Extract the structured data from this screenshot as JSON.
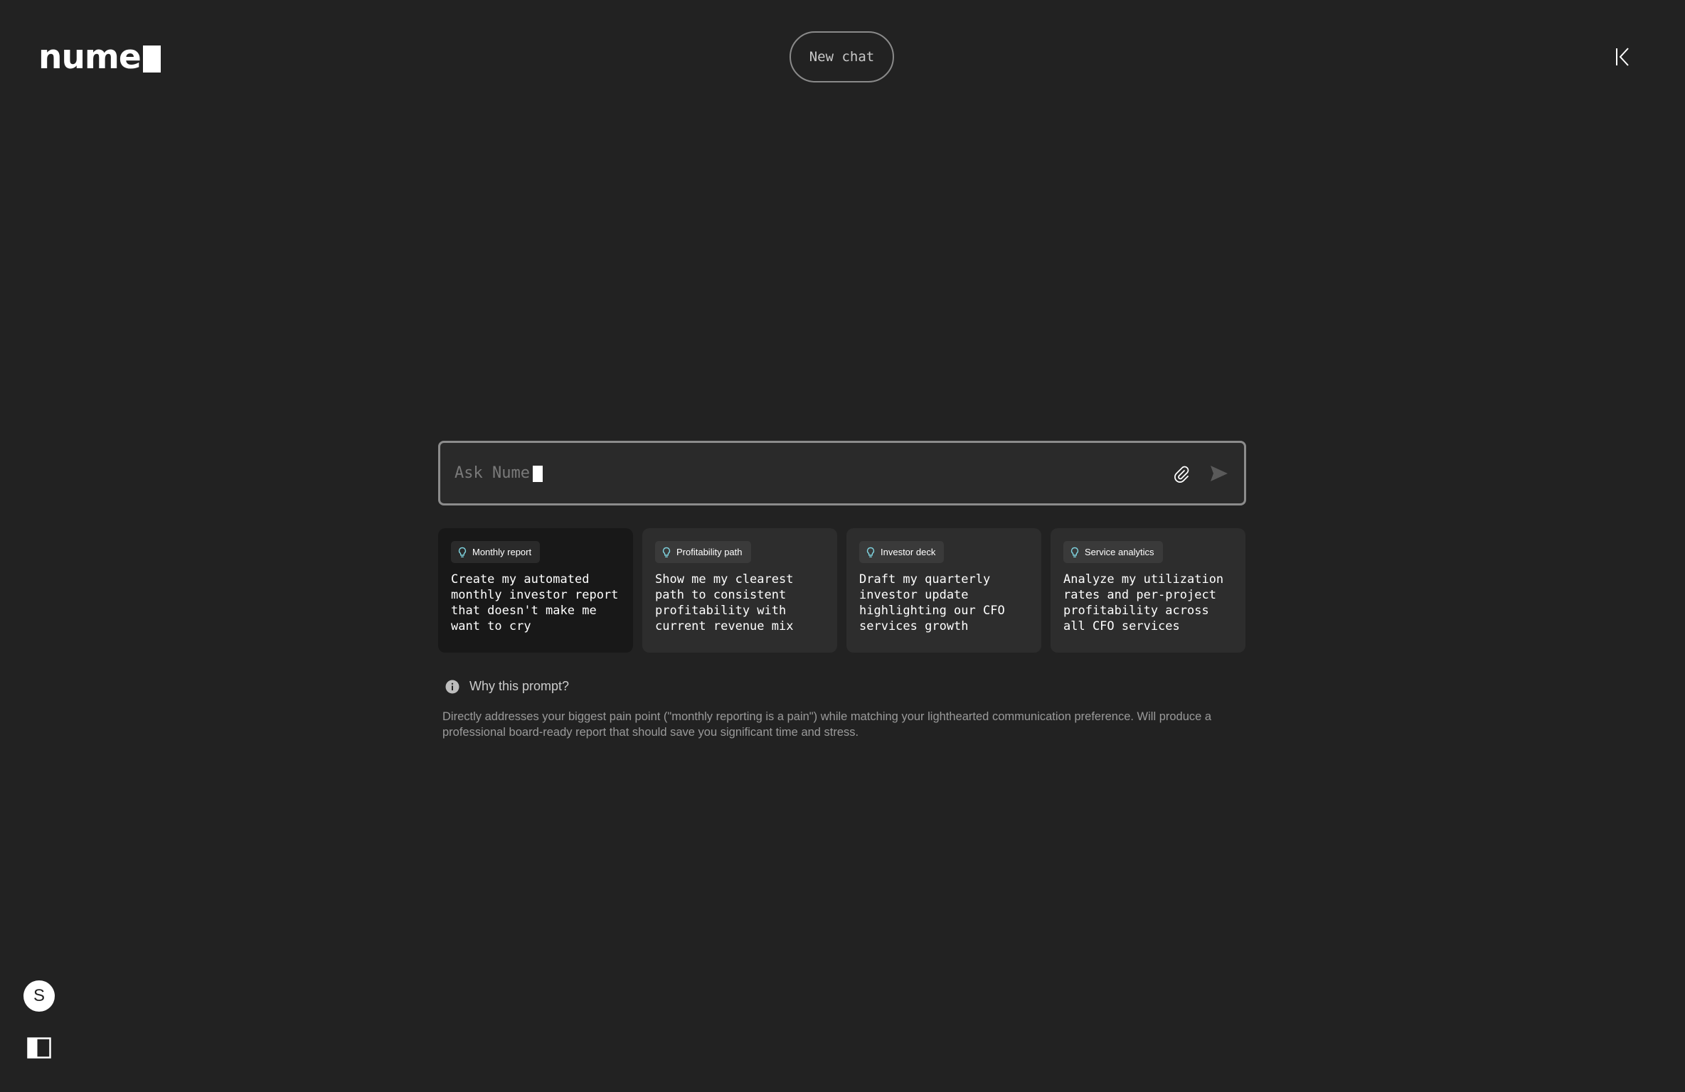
{
  "header": {
    "logo_text": "nume",
    "new_chat_label": "New chat",
    "collapse_icon": "collapse-left-icon"
  },
  "ask": {
    "placeholder": "Ask Nume",
    "attach_icon": "paperclip-icon",
    "send_icon": "send-icon"
  },
  "suggestions": [
    {
      "tag": "Monthly report",
      "icon": "lightbulb-icon",
      "text": "Create my automated monthly investor report that doesn't make me want to cry",
      "selected": true
    },
    {
      "tag": "Profitability path",
      "icon": "lightbulb-icon",
      "text": "Show me my clearest path to consistent profitability with current revenue mix",
      "selected": false
    },
    {
      "tag": "Investor deck",
      "icon": "lightbulb-icon",
      "text": "Draft my quarterly investor update highlighting our CFO services growth",
      "selected": false
    },
    {
      "tag": "Service analytics",
      "icon": "lightbulb-icon",
      "text": "Analyze my utilization rates and per-project profitability across all CFO services",
      "selected": false
    }
  ],
  "why": {
    "icon": "info-icon",
    "title": "Why this prompt?",
    "description": "Directly addresses your biggest pain point (\"monthly reporting is a pain\") while matching your lighthearted communication preference. Will produce a professional board-ready report that should save you significant time and stress."
  },
  "footer": {
    "avatar_initial": "S",
    "sidebar_icon": "sidebar-toggle-icon"
  },
  "colors": {
    "background": "#222222",
    "card": "#2d2d2d",
    "card_selected": "#181818",
    "tag": "#3a3a3a",
    "accent_icon": "#7fd4e0"
  }
}
